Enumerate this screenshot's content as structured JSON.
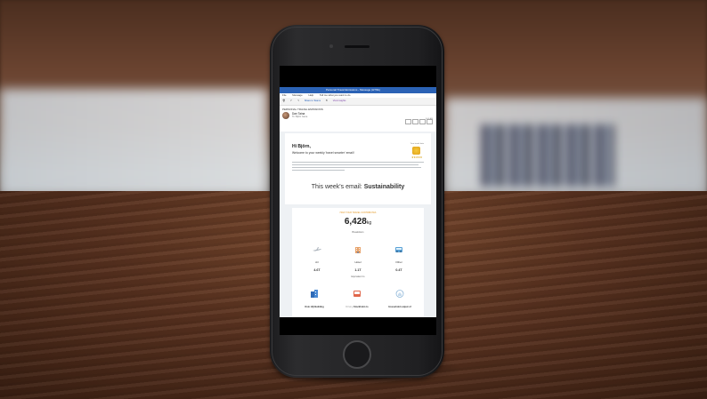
{
  "outlook": {
    "window_title": "Personal Travel Emissions - Message (HTML)",
    "tabs": [
      "File",
      "Message",
      "Help",
      "Tell me what you want to do"
    ],
    "ribbon": [
      "Share to Teams",
      "Viva Insights"
    ],
    "subject": "PERSONAL TRAVEL EMISSIONS",
    "sender": "Dan Taina",
    "to": "To: Björn Gene",
    "date": "9:00 AM"
  },
  "email": {
    "greeting": "Hi Björn,",
    "welcome": "Welcome to your weekly 'travel smarter' email!",
    "badge_text": "Your travel data",
    "stars": "★★★★★",
    "week_prefix": "This week's email: ",
    "week_topic": "Sustainability",
    "how_label": "HOW YOUR TRAVEL CONTRIBUTES",
    "total_value": "6,428",
    "total_unit": "kg",
    "breakdown_label": "Breakdown",
    "categories": [
      {
        "label": "Air",
        "value": "4.6T"
      },
      {
        "label": "Hotel",
        "value": "1.1T"
      },
      {
        "label": "Other",
        "value": "0.4T"
      }
    ],
    "explained_label": "Equivalent to",
    "equivalents": [
      {
        "label": "Oslo HQ Building",
        "extra": ""
      },
      {
        "label": "Stockholm to",
        "extra": "Driving "
      },
      {
        "label": "Household output of",
        "extra": ""
      }
    ]
  }
}
